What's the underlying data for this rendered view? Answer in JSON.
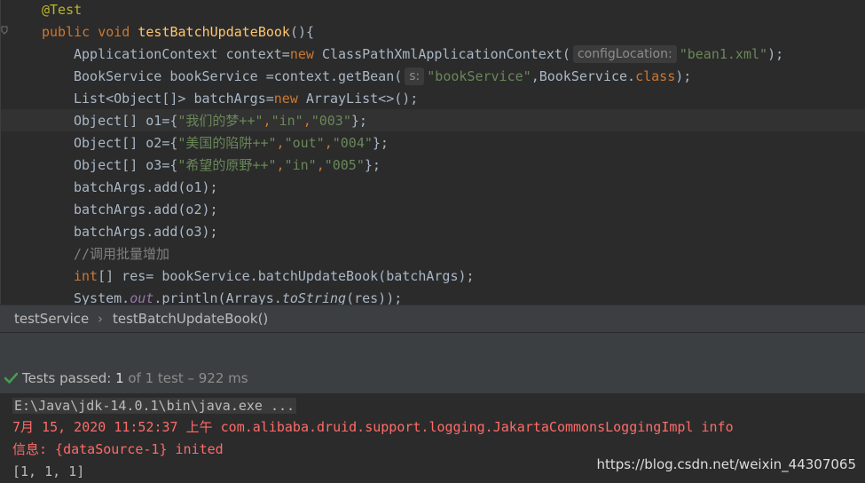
{
  "editor": {
    "lines": {
      "l1": {
        "ann": "@Test"
      },
      "l2": {
        "kw1": "public ",
        "kw2": "void ",
        "fn": "testBatchUpdateBook",
        "rest": "(){"
      },
      "l3": {
        "a": "ApplicationContext context=",
        "kw": "new ",
        "b": "ClassPathXmlApplicationContext(",
        "hint": "configLocation:",
        "str": "\"bean1.xml\"",
        "c": ");"
      },
      "l4": {
        "a": "BookService bookService =context.getBean(",
        "hint": "s:",
        "str": "\"bookService\"",
        "b": ",BookService.",
        "kw": "class",
        "c": ");"
      },
      "l5": {
        "a": "List<Object[]> batchArgs=",
        "kw": "new ",
        "b": "ArrayList<>();"
      },
      "l6": {
        "a": "Object[] o1={",
        "s1": "\"我们的梦++\"",
        "s2": "\"in\"",
        "s3": "\"003\"",
        "c": "};",
        "comma": ","
      },
      "l7": {
        "a": "Object[] o2={",
        "s1": "\"美国的陷阱++\"",
        "s2": "\"out\"",
        "s3": "\"004\"",
        "c": "};",
        "comma": ","
      },
      "l8": {
        "a": "Object[] o3={",
        "s1": "\"希望的原野++\"",
        "s2": "\"in\"",
        "s3": "\"005\"",
        "c": "};",
        "comma": ","
      },
      "l9": {
        "a": "batchArgs.add(o1);"
      },
      "l10": {
        "a": "batchArgs.add(o2);"
      },
      "l11": {
        "a": "batchArgs.add(o3);"
      },
      "l12": {
        "cmt": "//调用批量增加"
      },
      "l13": {
        "kw": "int",
        "a": "[] res= bookService.batchUpdateBook(batchArgs);"
      },
      "l14": {
        "a": "System.",
        "out": "out",
        "b": ".println(Arrays.",
        "ts": "toString",
        "c": "(res));"
      }
    }
  },
  "breadcrumb": {
    "item1": "testService",
    "sep": "›",
    "item2": "testBatchUpdateBook()"
  },
  "status": {
    "label": "Tests passed:",
    "count": "1",
    "of": " of 1 test – 922 ms"
  },
  "console": {
    "cmd": "E:\\Java\\jdk-14.0.1\\bin\\java.exe ...",
    "log1": "7月 15, 2020 11:52:37 上午 com.alibaba.druid.support.logging.JakartaCommonsLoggingImpl info",
    "log2": "信息: {dataSource-1} inited",
    "result": "[1, 1, 1]"
  },
  "watermark": "https://blog.csdn.net/weixin_44307065",
  "colors": {
    "accent_green": "#499c54",
    "error_red": "#ff6b68",
    "keyword": "#cc7832",
    "string": "#6a8759"
  }
}
